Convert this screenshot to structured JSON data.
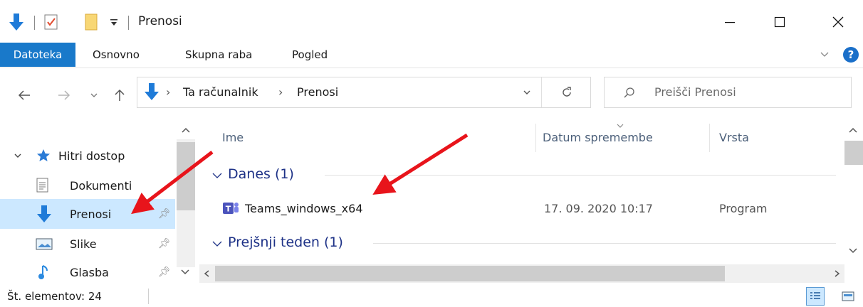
{
  "window": {
    "title": "Prenosi",
    "minimize_label": "—",
    "maximize_label": "☐",
    "close_label": "✕"
  },
  "ribbon": {
    "tabs": [
      "Datoteka",
      "Osnovno",
      "Skupna raba",
      "Pogled"
    ],
    "expand_glyph": "∨",
    "help_glyph": "?"
  },
  "address": {
    "crumbs": [
      "Ta računalnik",
      "Prenosi"
    ],
    "separator": "›"
  },
  "search": {
    "placeholder": "Preišči Prenosi"
  },
  "nav": {
    "quick_access": "Hitri dostop",
    "items": [
      {
        "label": "Dokumenti",
        "icon": "document-icon",
        "pinned": false
      },
      {
        "label": "Prenosi",
        "icon": "download-arrow-icon",
        "pinned": true,
        "selected": true
      },
      {
        "label": "Slike",
        "icon": "pictures-icon",
        "pinned": true
      },
      {
        "label": "Glasba",
        "icon": "music-icon",
        "pinned": true
      }
    ]
  },
  "columns": {
    "name": "Ime",
    "date": "Datum spremembe",
    "type": "Vrsta"
  },
  "groups": [
    {
      "label": "Danes (1)"
    },
    {
      "label": "Prejšnji teden (1)"
    }
  ],
  "files": [
    {
      "name": "Teams_windows_x64",
      "date": "17. 09. 2020 10:17",
      "type": "Program",
      "icon": "teams-icon"
    }
  ],
  "statusbar": {
    "count": "Št. elementov: 24"
  },
  "colors": {
    "accent": "#1979ca",
    "selection": "#cce8ff",
    "group_text": "#1e3287",
    "annotation_arrow": "#e8141b"
  }
}
